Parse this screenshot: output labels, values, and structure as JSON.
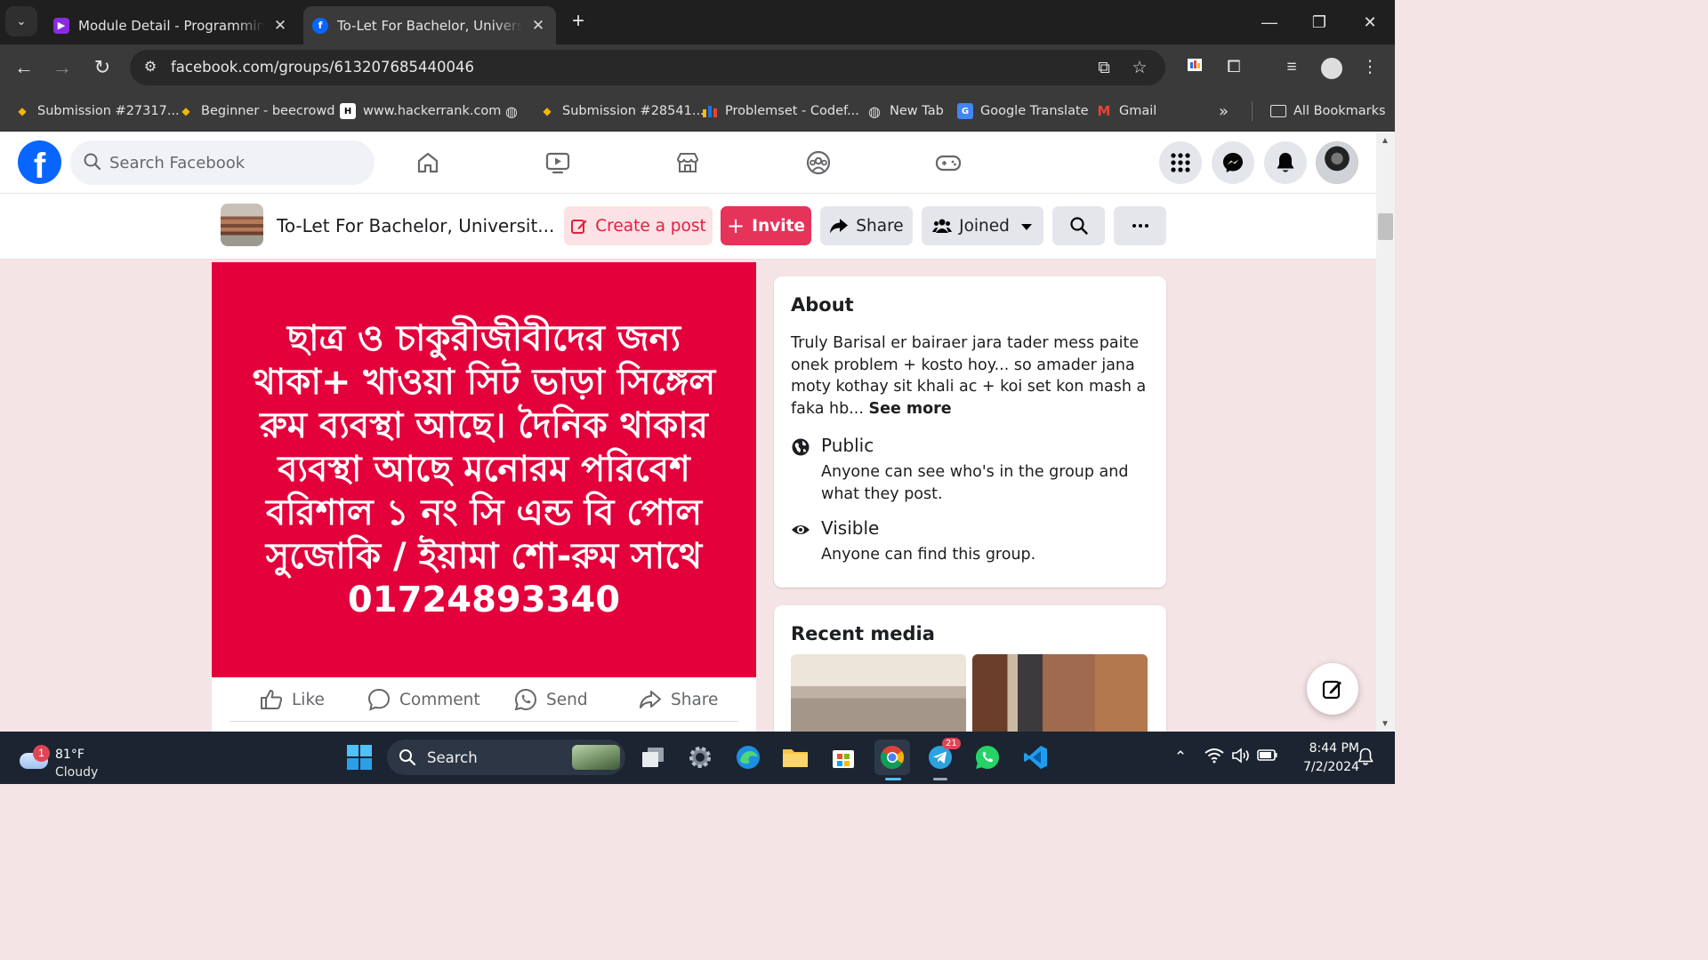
{
  "browser": {
    "tabs": [
      {
        "title": "Module Detail - Programming Hero",
        "active": false
      },
      {
        "title": "To-Let For Bachelor, University",
        "active": true
      }
    ],
    "url": "facebook.com/groups/613207685440046",
    "bookmarks": [
      {
        "label": "Submission #27317...",
        "icon": "beecrowd-icon"
      },
      {
        "label": "Beginner - beecrowd",
        "icon": "beecrowd-icon"
      },
      {
        "label": "www.hackerrank.com",
        "icon": "hackerrank-icon"
      },
      {
        "label": "",
        "icon": "globe-icon"
      },
      {
        "label": "Submission #28541...",
        "icon": "beecrowd-icon"
      },
      {
        "label": "Problemset - Codef...",
        "icon": "codeforces-icon"
      },
      {
        "label": "New Tab",
        "icon": "globe-icon"
      },
      {
        "label": "Google Translate",
        "icon": "google-translate-icon"
      },
      {
        "label": "Gmail",
        "icon": "gmail-icon"
      }
    ],
    "all_bookmarks_label": "All Bookmarks"
  },
  "fb": {
    "search_placeholder": "Search Facebook",
    "group": {
      "name": "To-Let For Bachelor, Universit...",
      "create_post_label": "Create a post",
      "invite_label": "Invite",
      "share_label": "Share",
      "joined_label": "Joined"
    },
    "post": {
      "image_text": "ছাত্র ও চাকুরীজীবীদের জন্য থাকা+ খাওয়া সিট ভাড়া সিঙ্গেল রুম ব্যবস্থা আছে। দৈনিক থাকার ব্যবস্থা আছে মনোরম পরিবেশ বরিশাল ১ নং সি এন্ড বি পোল সুজোকি / ইয়ামা শো-রুম সাথে 01724893340",
      "actions": {
        "like": "Like",
        "comment": "Comment",
        "send": "Send",
        "share": "Share"
      }
    },
    "about": {
      "title": "About",
      "description": "Truly Barisal er bairaer jara tader mess paite onek problem + kosto hoy... so amader jana moty kothay sit khali ac + koi set kon mash a faka hb...",
      "see_more": "See more",
      "privacy_title": "Public",
      "privacy_desc": "Anyone can see who's in the group and what they post.",
      "visibility_title": "Visible",
      "visibility_desc": "Anyone can find this group."
    },
    "recent_media": {
      "title": "Recent media"
    }
  },
  "taskbar": {
    "weather": {
      "temp": "81°F",
      "condition": "Cloudy",
      "badge": "1"
    },
    "search_label": "Search",
    "telegram_badge": "21",
    "time": "8:44 PM",
    "date": "7/2/2024"
  },
  "colors": {
    "fb_blue": "#0866ff",
    "post_bg": "#e3003b",
    "invite_bg": "#e6335a",
    "create_post_text": "#e41e3f",
    "page_bg": "#f5e4e6"
  }
}
